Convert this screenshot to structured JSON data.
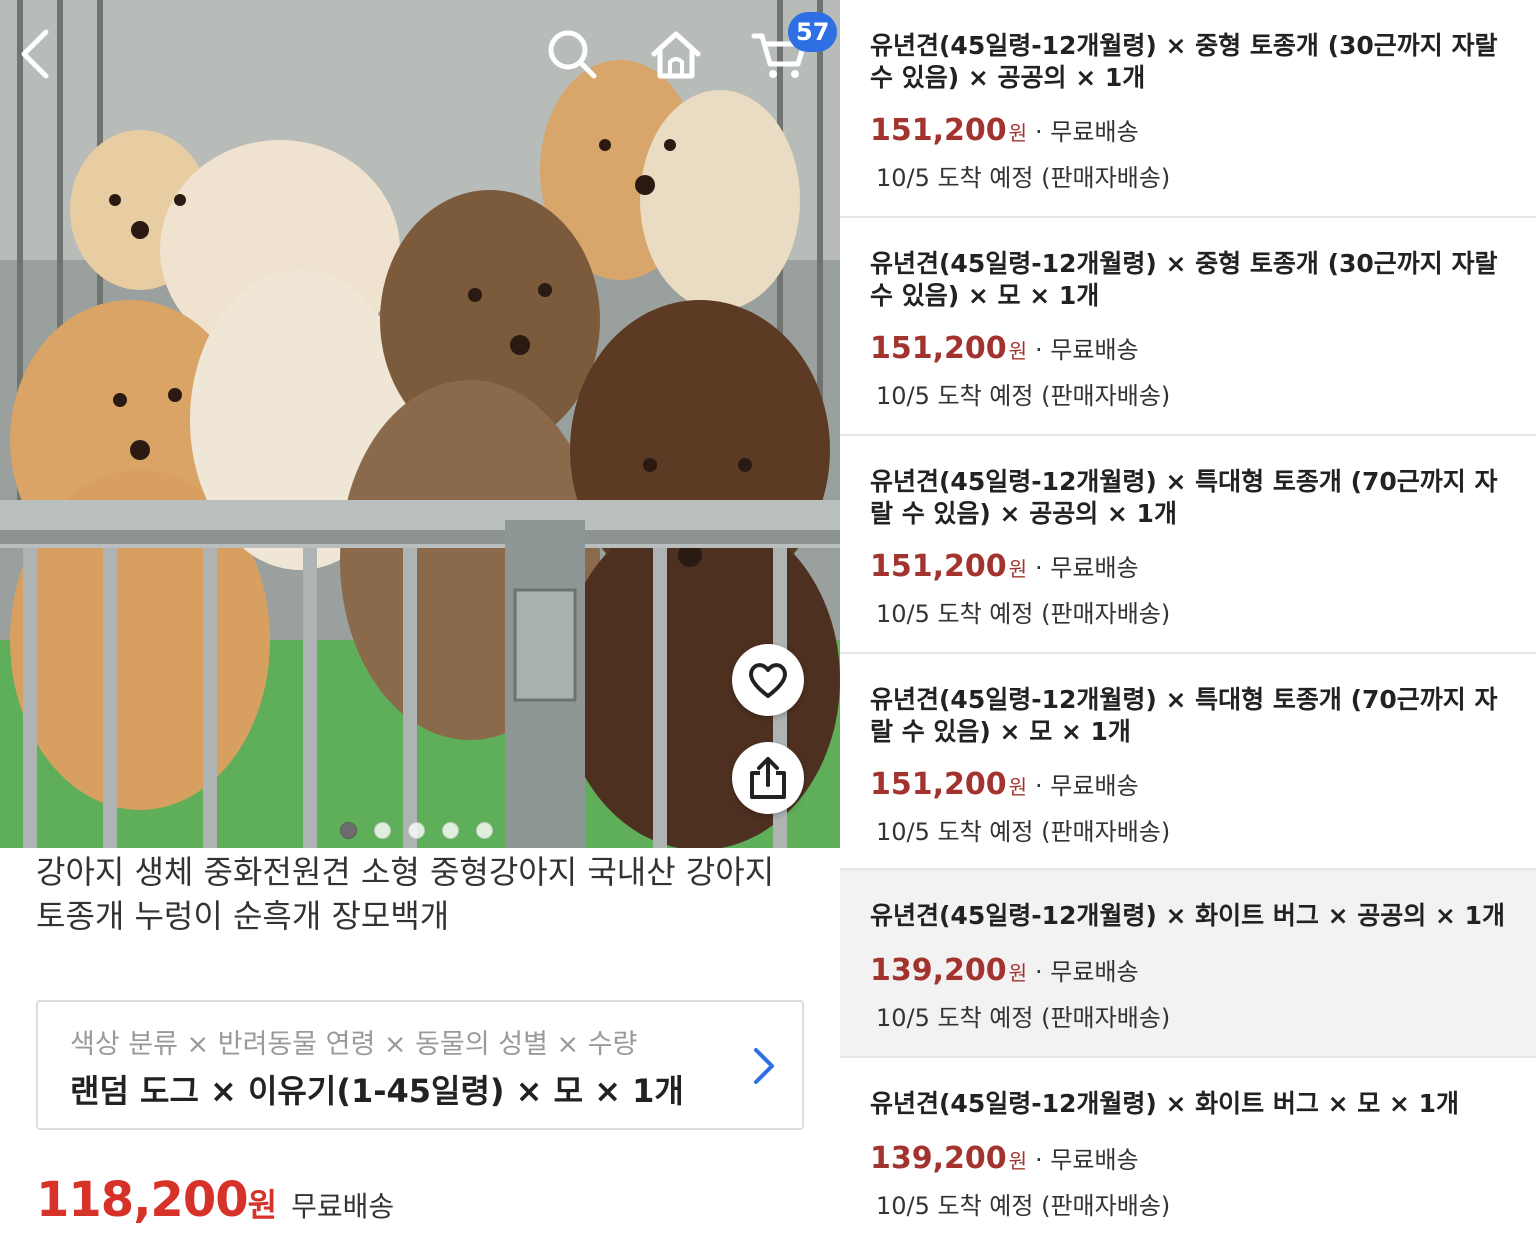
{
  "header": {
    "cart_count": "57"
  },
  "gallery": {
    "pages": 5,
    "active_page": 1
  },
  "product": {
    "title": "강아지 생체 중화전원견 소형 중형강아지 국내산 강아지 토종개 누렁이 순흑개 장모백개",
    "option_labels": "색상 분류 × 반려동물 연령 × 동물의 성별 × 수량",
    "option_value": "랜덤 도그 × 이유기(1-45일령) × 모 × 1개",
    "price": "118,200",
    "currency": "원",
    "shipping": "무료배송"
  },
  "options": [
    {
      "name": "유년견(45일령-12개월령) × 중형 토종개 (30근까지 자랄 수 있음) × 공공의 × 1개",
      "price": "151,200",
      "currency": "원",
      "shipping": "· 무료배송",
      "eta": "10/5 도착 예정 (판매자배송)"
    },
    {
      "name": "유년견(45일령-12개월령) × 중형 토종개 (30근까지 자랄 수 있음) × 모 × 1개",
      "price": "151,200",
      "currency": "원",
      "shipping": "· 무료배송",
      "eta": "10/5 도착 예정 (판매자배송)"
    },
    {
      "name": "유년견(45일령-12개월령) × 특대형 토종개 (70근까지 자랄 수 있음) × 공공의 × 1개",
      "price": "151,200",
      "currency": "원",
      "shipping": "· 무료배송",
      "eta": "10/5 도착 예정 (판매자배송)"
    },
    {
      "name": "유년견(45일령-12개월령) × 특대형 토종개 (70근까지 자랄 수 있음) × 모 × 1개",
      "price": "151,200",
      "currency": "원",
      "shipping": "· 무료배송",
      "eta": "10/5 도착 예정 (판매자배송)"
    },
    {
      "name": "유년견(45일령-12개월령) × 화이트 버그 × 공공의 × 1개",
      "price": "139,200",
      "currency": "원",
      "shipping": "· 무료배송",
      "eta": "10/5 도착 예정 (판매자배송)"
    },
    {
      "name": "유년견(45일령-12개월령) × 화이트 버그 × 모 × 1개",
      "price": "139,200",
      "currency": "원",
      "shipping": "· 무료배송",
      "eta": "10/5 도착 예정 (판매자배송)"
    }
  ],
  "selected_option_index": 4,
  "colors": {
    "price_red": "#d7322a",
    "option_price": "#a2332e",
    "badge_blue": "#2f6fe4"
  },
  "icons": [
    "back-arrow-icon",
    "search-icon",
    "home-icon",
    "cart-icon",
    "heart-icon",
    "share-icon",
    "chevron-right-icon"
  ]
}
